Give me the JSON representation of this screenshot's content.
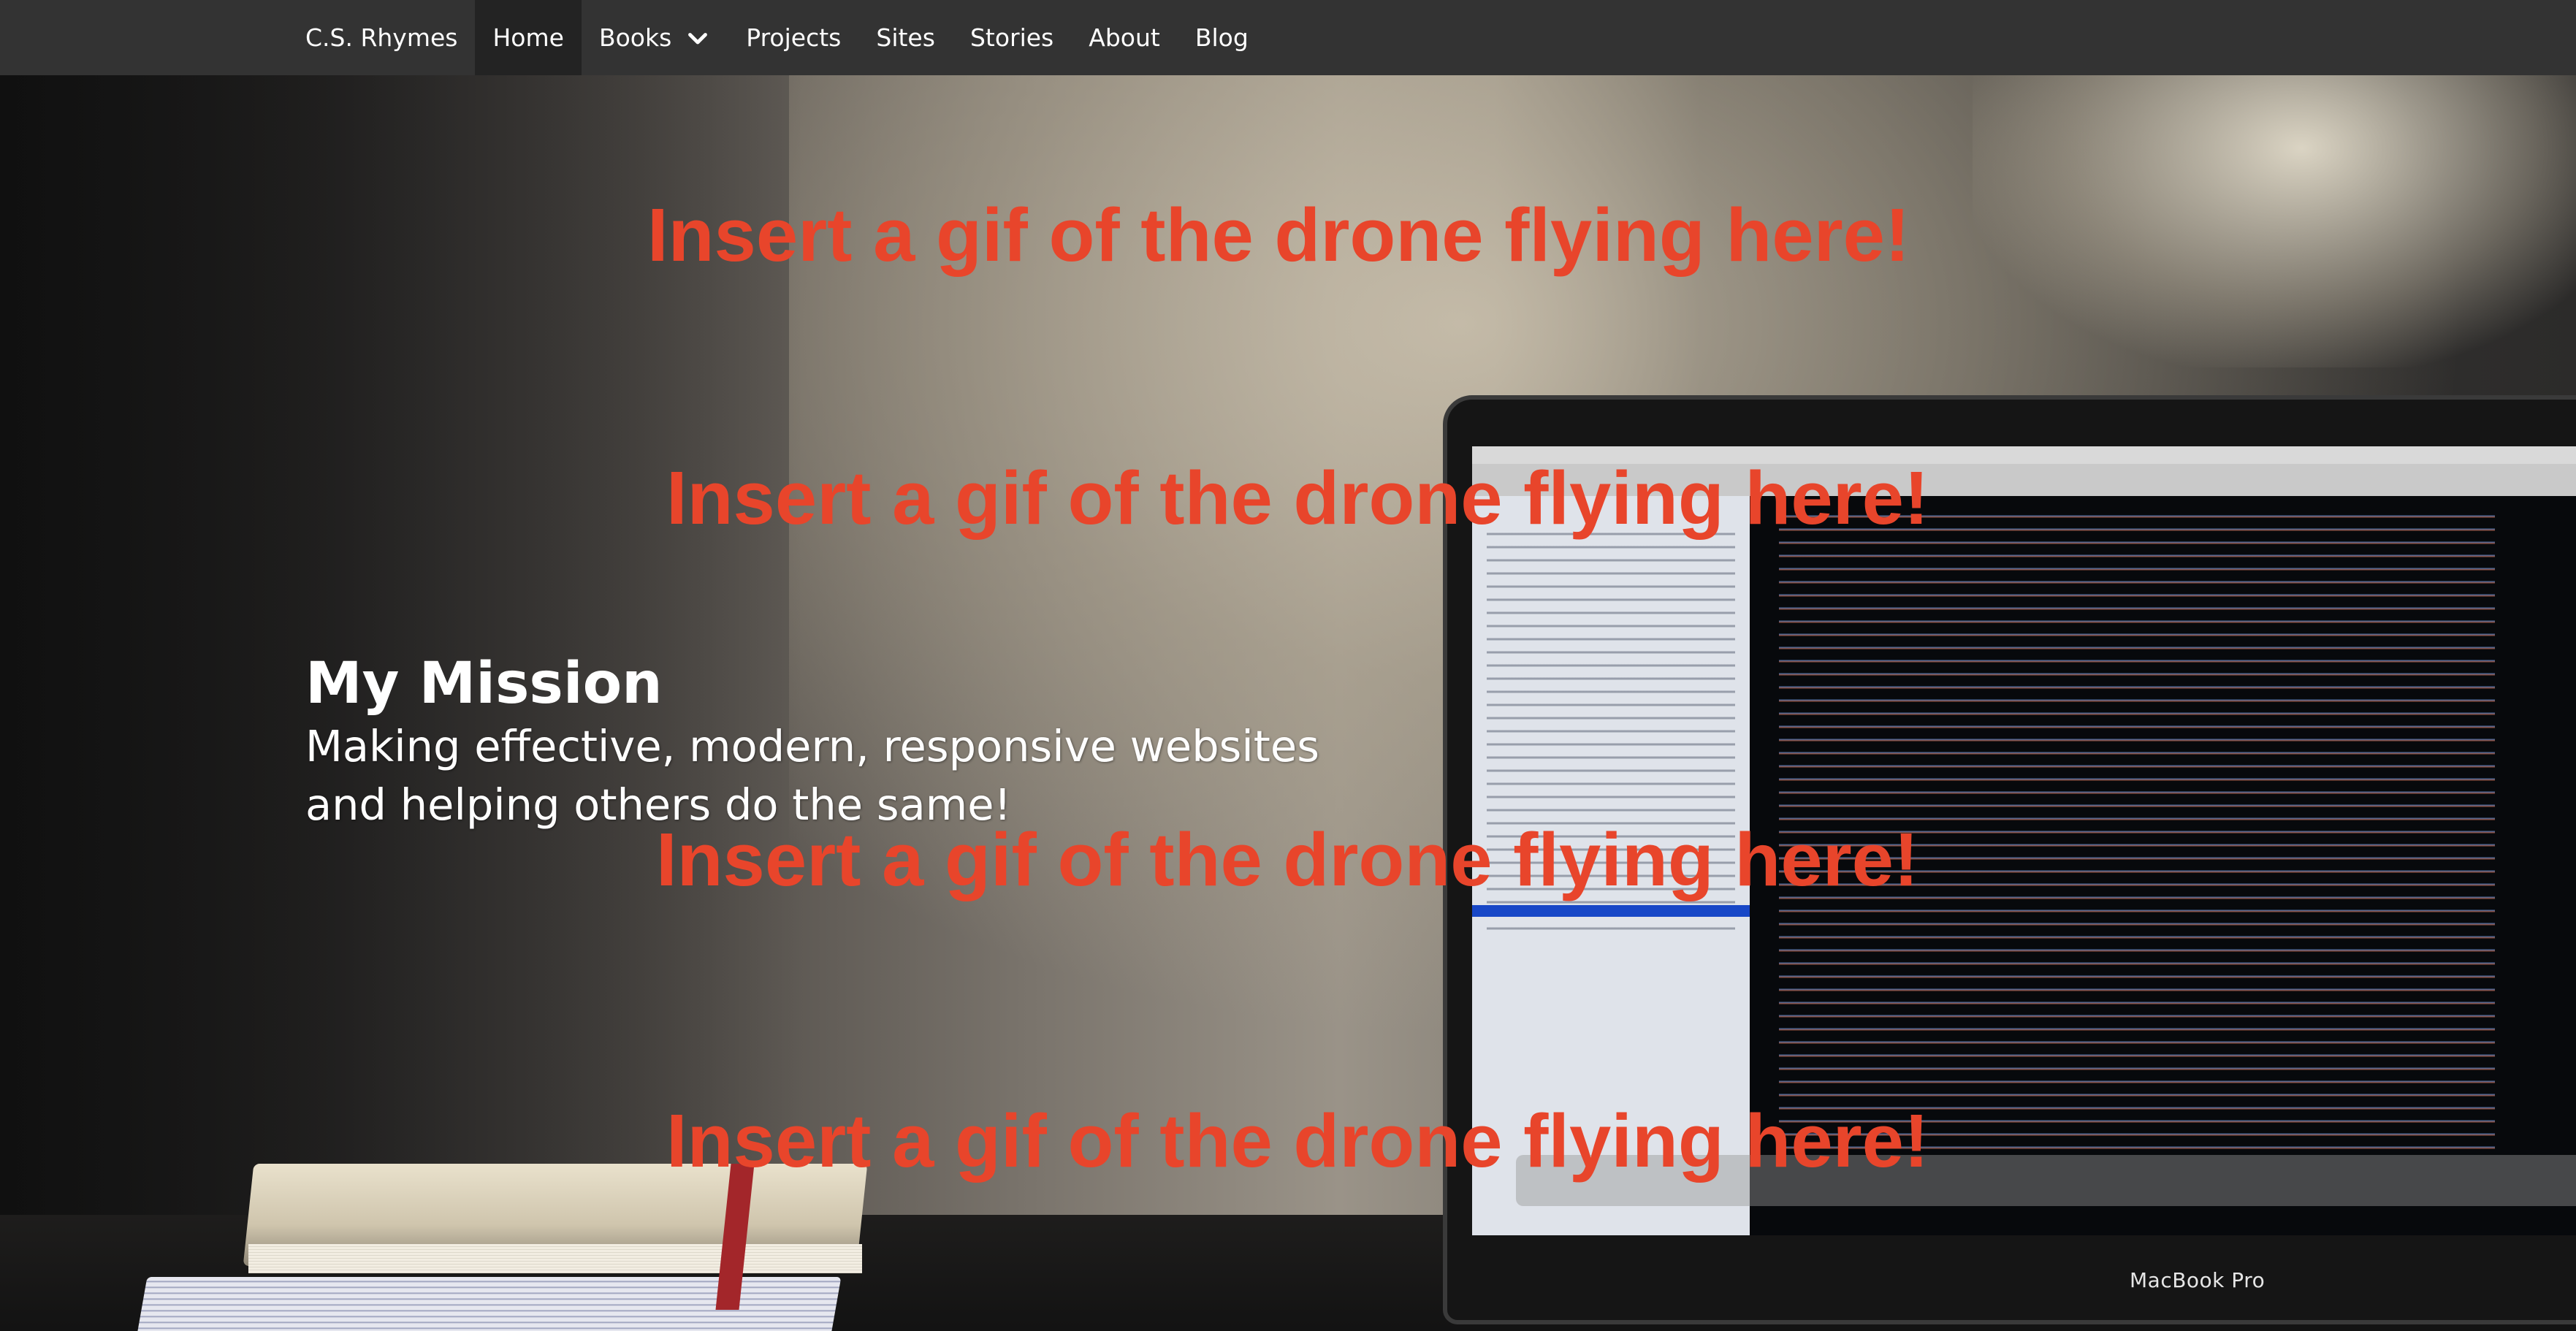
{
  "navbar": {
    "items": [
      {
        "label": "C.S. Rhymes"
      },
      {
        "label": "Home",
        "active": true
      },
      {
        "label": "Books",
        "has_dropdown": true,
        "icon": "chevron-down-icon"
      },
      {
        "label": "Projects"
      },
      {
        "label": "Sites"
      },
      {
        "label": "Stories"
      },
      {
        "label": "About"
      },
      {
        "label": "Blog"
      }
    ]
  },
  "hero": {
    "mission_title": "My Mission",
    "mission_line_1": "Making effective, modern, responsive websites",
    "mission_line_2": "and helping others do the same!",
    "laptop_brand": "MacBook Pro"
  },
  "drone_placeholders": [
    "Insert a gif of the drone flying here!",
    "Insert a gif of the drone flying here!",
    "Insert a gif of the drone flying here!",
    "Insert a gif of the drone flying here!"
  ],
  "colors": {
    "navbar_bg": "#333333",
    "navbar_active_bg": "#232323",
    "placeholder_text": "#e8452b",
    "hero_text": "#ffffff"
  }
}
